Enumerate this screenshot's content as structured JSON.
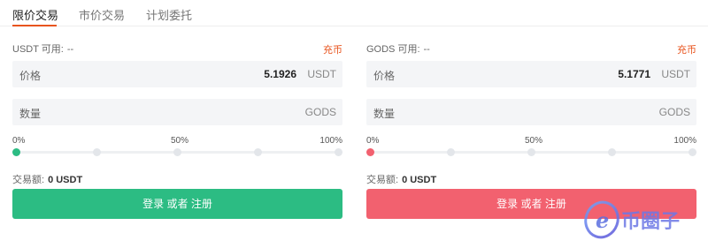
{
  "colors": {
    "accent": "#e8541e",
    "buy": "#2cbc83",
    "sell": "#f2616f",
    "field_bg": "#f4f5f7"
  },
  "tabs": [
    {
      "label": "限价交易",
      "active": true
    },
    {
      "label": "市价交易",
      "active": false
    },
    {
      "label": "计划委托",
      "active": false
    }
  ],
  "buy": {
    "available_label": "USDT 可用:",
    "available_value": "--",
    "deposit_label": "充币",
    "price_label": "价格",
    "price_value": "5.1926",
    "price_unit": "USDT",
    "qty_label": "数量",
    "qty_unit": "GODS",
    "slider": {
      "start": "0%",
      "mid": "50%",
      "end": "100%",
      "value": 0
    },
    "amount_label": "交易额:",
    "amount_value": "0 USDT",
    "submit_label": "登录 或者 注册"
  },
  "sell": {
    "available_label": "GODS 可用:",
    "available_value": "--",
    "deposit_label": "充币",
    "price_label": "价格",
    "price_value": "5.1771",
    "price_unit": "USDT",
    "qty_label": "数量",
    "qty_unit": "GODS",
    "slider": {
      "start": "0%",
      "mid": "50%",
      "end": "100%",
      "value": 0
    },
    "amount_label": "交易额:",
    "amount_value": "0 USDT",
    "submit_label": "登录 或者 注册"
  },
  "watermark": {
    "text": "币圈子"
  }
}
